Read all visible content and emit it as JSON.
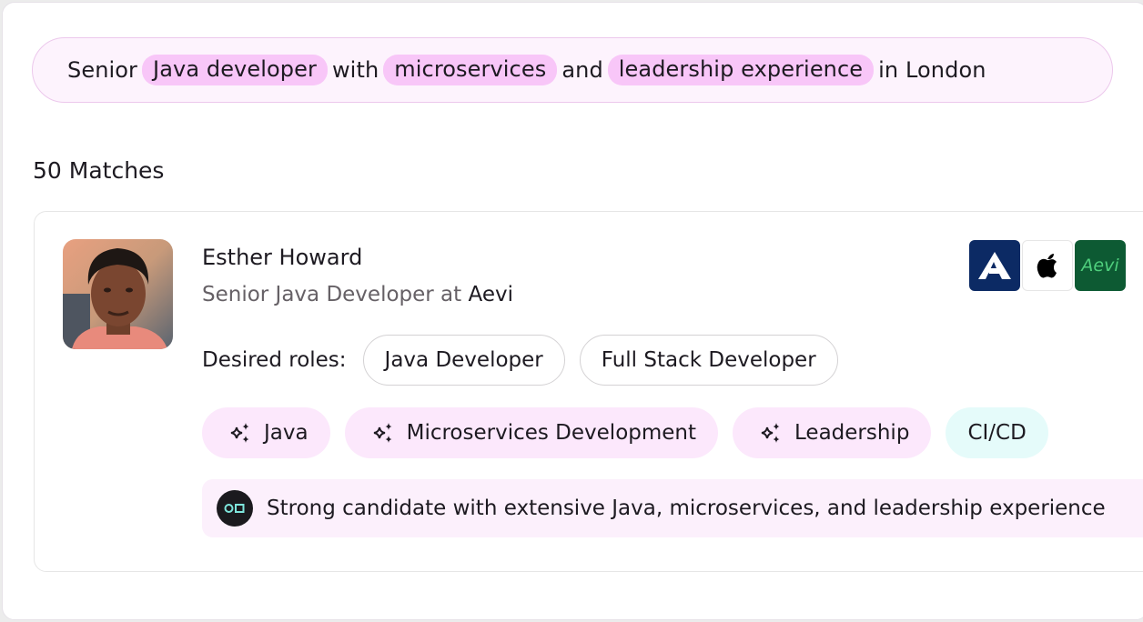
{
  "search_query": {
    "segments": [
      {
        "text": "Senior",
        "highlight": false
      },
      {
        "text": "Java developer",
        "highlight": true
      },
      {
        "text": "with",
        "highlight": false
      },
      {
        "text": "microservices",
        "highlight": true
      },
      {
        "text": "and",
        "highlight": false
      },
      {
        "text": "leadership experience",
        "highlight": true
      },
      {
        "text": "in London",
        "highlight": false
      }
    ]
  },
  "results": {
    "count_label": "50 Matches"
  },
  "candidate": {
    "name": "Esther Howard",
    "title_prefix": "Senior Java Developer at",
    "company": "Aevi",
    "company_logos": [
      {
        "name": "airbus-logo",
        "glyph": "A"
      },
      {
        "name": "apple-logo",
        "glyph": ""
      },
      {
        "name": "aevi-logo",
        "glyph": "Aevi"
      }
    ],
    "desired_roles_label": "Desired roles:",
    "desired_roles": [
      "Java Developer",
      "Full Stack Developer"
    ],
    "skills": [
      {
        "label": "Java",
        "ai_match": true
      },
      {
        "label": "Microservices Development",
        "ai_match": true
      },
      {
        "label": "Leadership",
        "ai_match": true
      },
      {
        "label": "CI/CD",
        "ai_match": false
      }
    ],
    "summary": "Strong candidate with extensive Java, microservices, and leadership experience"
  },
  "colors": {
    "highlight": "#f8c6f8",
    "query_bg": "#fdf3fd",
    "skill_ai_bg": "#fce8fc",
    "skill_plain_bg": "#e5fbfa",
    "summary_bg": "#fcf0fc",
    "ai_badge_accent": "#7ee6dc"
  }
}
